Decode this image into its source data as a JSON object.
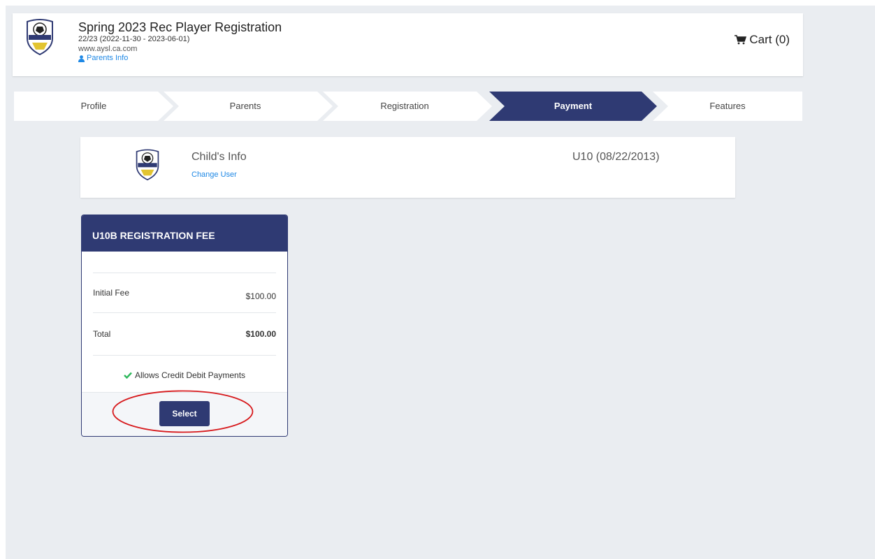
{
  "header": {
    "title": "Spring 2023 Rec Player Registration",
    "season": "22/23 (2022-11-30 - 2023-06-01)",
    "website": "www.aysl.ca.com",
    "parents_info": "Parents Info",
    "cart_label": "Cart (0)"
  },
  "steps": [
    {
      "label": "Profile",
      "active": false
    },
    {
      "label": "Parents",
      "active": false
    },
    {
      "label": "Registration",
      "active": false
    },
    {
      "label": "Payment",
      "active": true
    },
    {
      "label": "Features",
      "active": false
    }
  ],
  "child": {
    "title": "Child's Info",
    "change_user": "Change User",
    "age_group": "U10 (08/22/2013)"
  },
  "fee": {
    "title": "U10B REGISTRATION FEE",
    "initial_label": "Initial Fee",
    "initial_value": "$100.00",
    "total_label": "Total",
    "total_value": "$100.00",
    "allows": "Allows Credit Debit Payments",
    "select_label": "Select"
  },
  "colors": {
    "primary": "#2f3a73",
    "link": "#1e88e5",
    "check": "#2eb85c",
    "highlight": "#d7191c"
  }
}
